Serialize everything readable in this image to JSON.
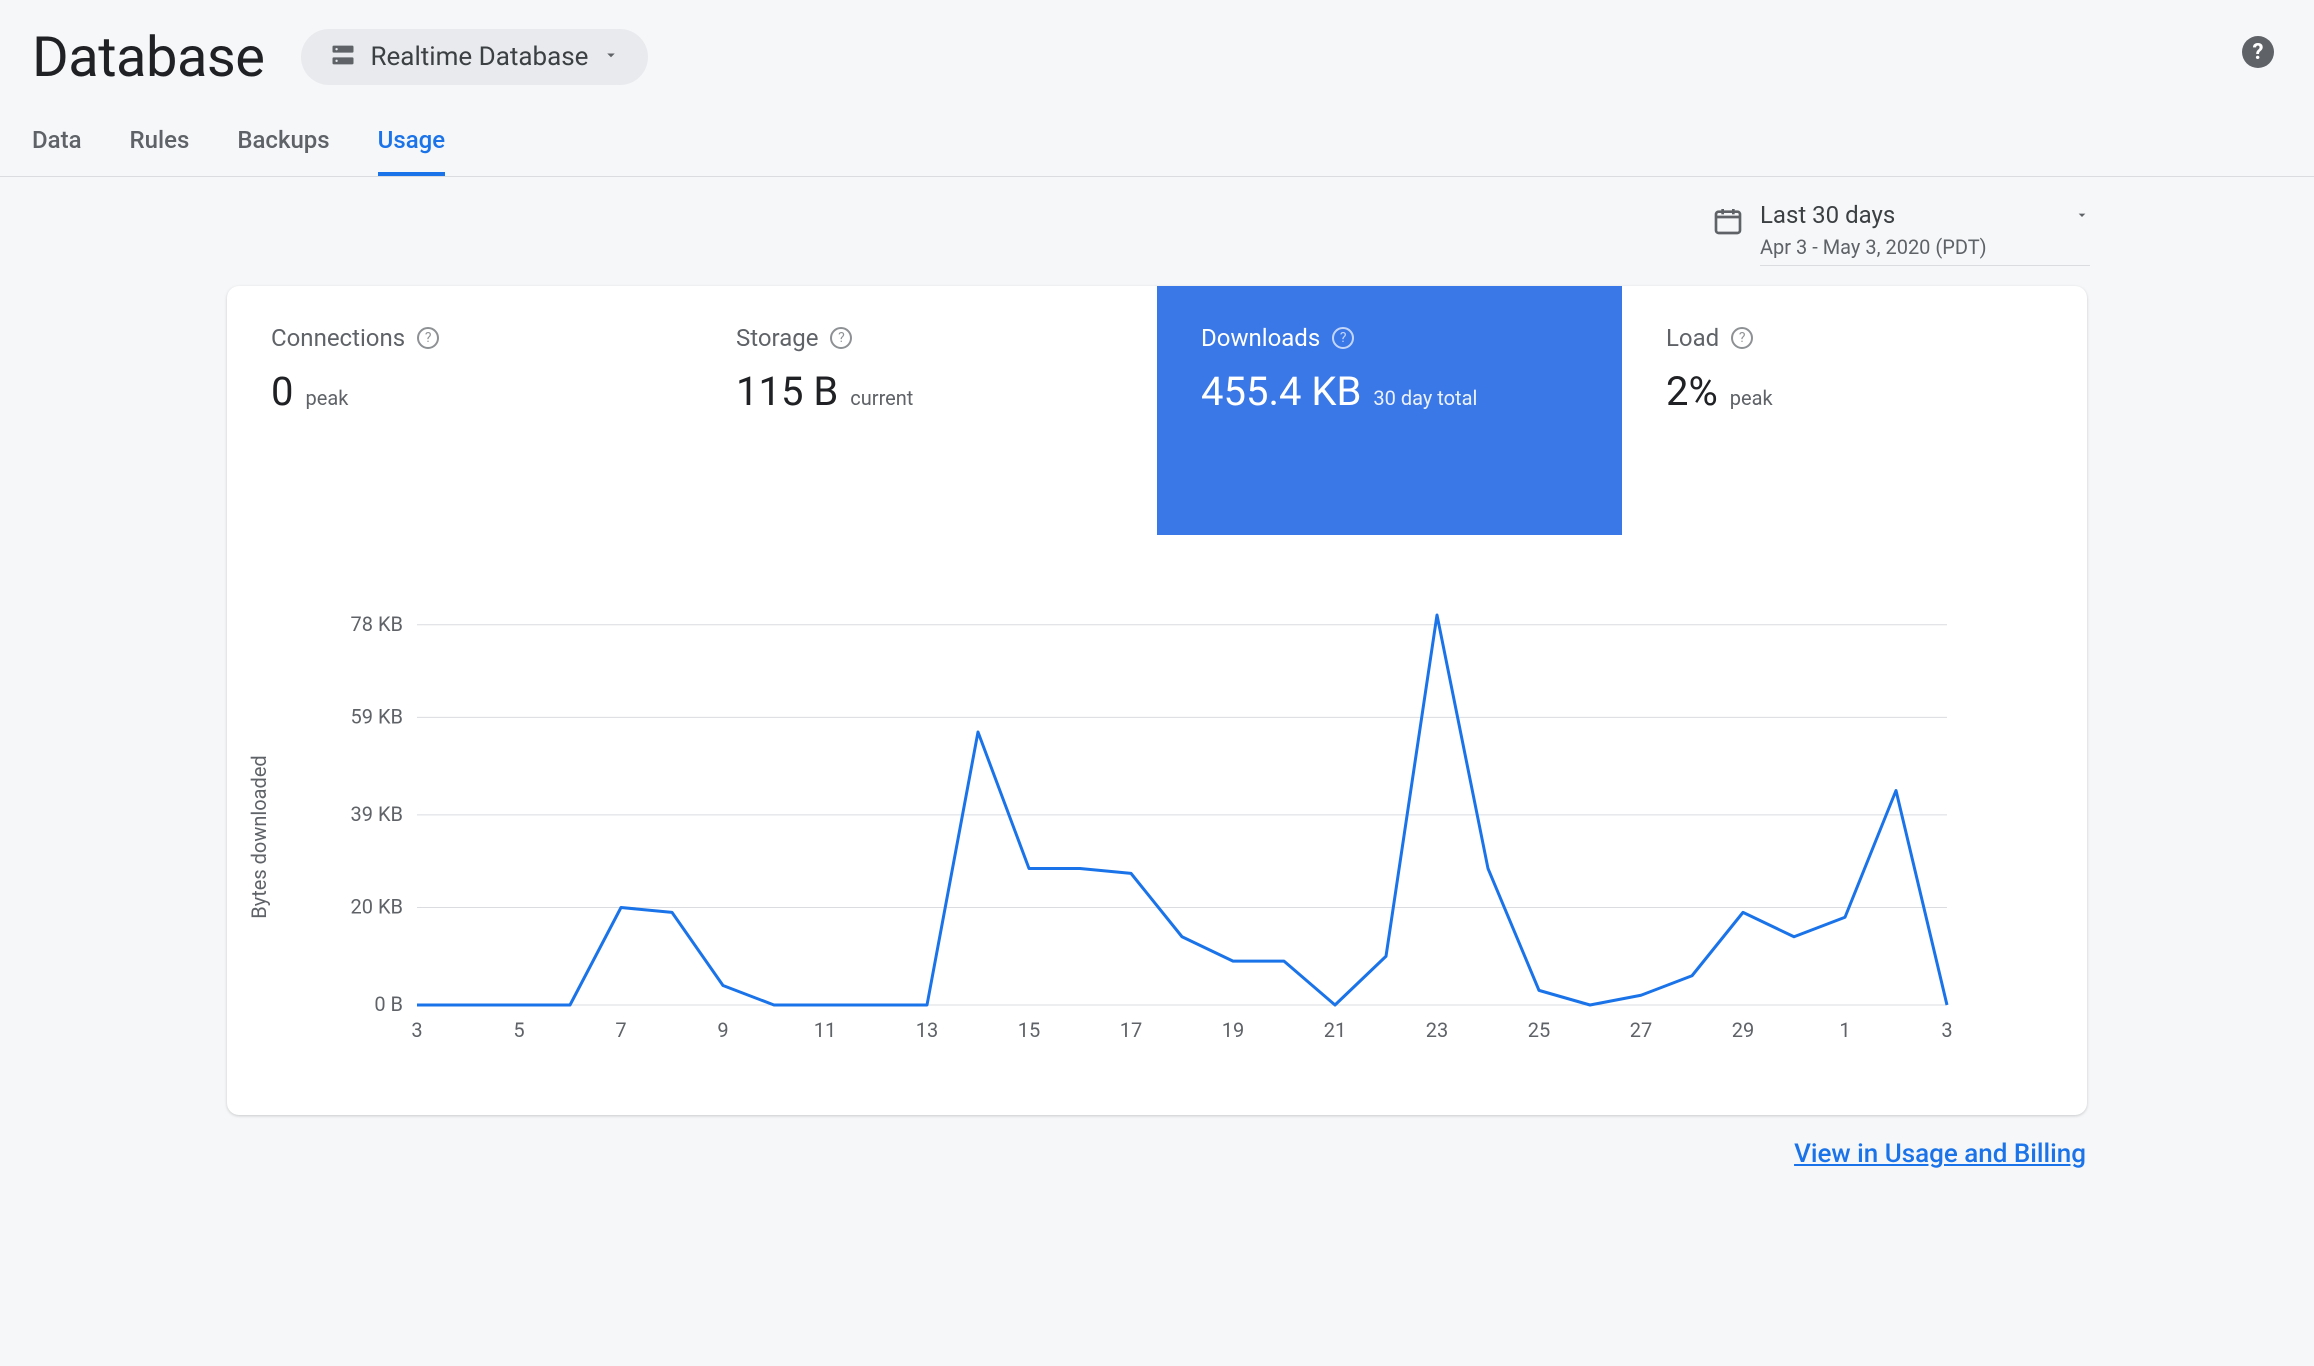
{
  "header": {
    "title": "Database",
    "dropdown_label": "Realtime Database"
  },
  "tabs": [
    {
      "label": "Data",
      "active": false
    },
    {
      "label": "Rules",
      "active": false
    },
    {
      "label": "Backups",
      "active": false
    },
    {
      "label": "Usage",
      "active": true
    }
  ],
  "date_selector": {
    "range": "Last 30 days",
    "subrange": "Apr 3 - May 3, 2020 (PDT)"
  },
  "metrics": {
    "connections": {
      "label": "Connections",
      "value": "0",
      "sub": "peak"
    },
    "storage": {
      "label": "Storage",
      "value": "115 B",
      "sub": "current"
    },
    "downloads": {
      "label": "Downloads",
      "value": "455.4 KB",
      "sub": "30 day total",
      "selected": true
    },
    "load": {
      "label": "Load",
      "value": "2%",
      "sub": "peak"
    }
  },
  "chart_data": {
    "type": "line",
    "title": "",
    "xlabel": "",
    "ylabel": "Bytes downloaded",
    "ylim": [
      0,
      80
    ],
    "y_unit": "KB",
    "y_ticks": [
      {
        "v": 0,
        "label": "0 B"
      },
      {
        "v": 20,
        "label": "20 KB"
      },
      {
        "v": 39,
        "label": "39 KB"
      },
      {
        "v": 59,
        "label": "59 KB"
      },
      {
        "v": 78,
        "label": "78 KB"
      }
    ],
    "x_tick_labels": [
      "3",
      "5",
      "7",
      "9",
      "11",
      "13",
      "15",
      "17",
      "19",
      "21",
      "23",
      "25",
      "27",
      "29",
      "1",
      "3"
    ],
    "categories": [
      "3",
      "4",
      "5",
      "6",
      "7",
      "8",
      "9",
      "10",
      "11",
      "12",
      "13",
      "14",
      "15",
      "16",
      "17",
      "18",
      "19",
      "20",
      "21",
      "22",
      "23",
      "24",
      "25",
      "26",
      "27",
      "28",
      "29",
      "30",
      "1",
      "2",
      "3"
    ],
    "values": [
      0,
      0,
      0,
      0,
      20,
      19,
      4,
      0,
      0,
      0,
      0,
      56,
      28,
      28,
      27,
      14,
      9,
      9,
      0,
      10,
      80,
      28,
      3,
      0,
      2,
      6,
      19,
      14,
      18,
      44,
      0
    ]
  },
  "footer": {
    "link_label": "View in Usage and Billing"
  }
}
